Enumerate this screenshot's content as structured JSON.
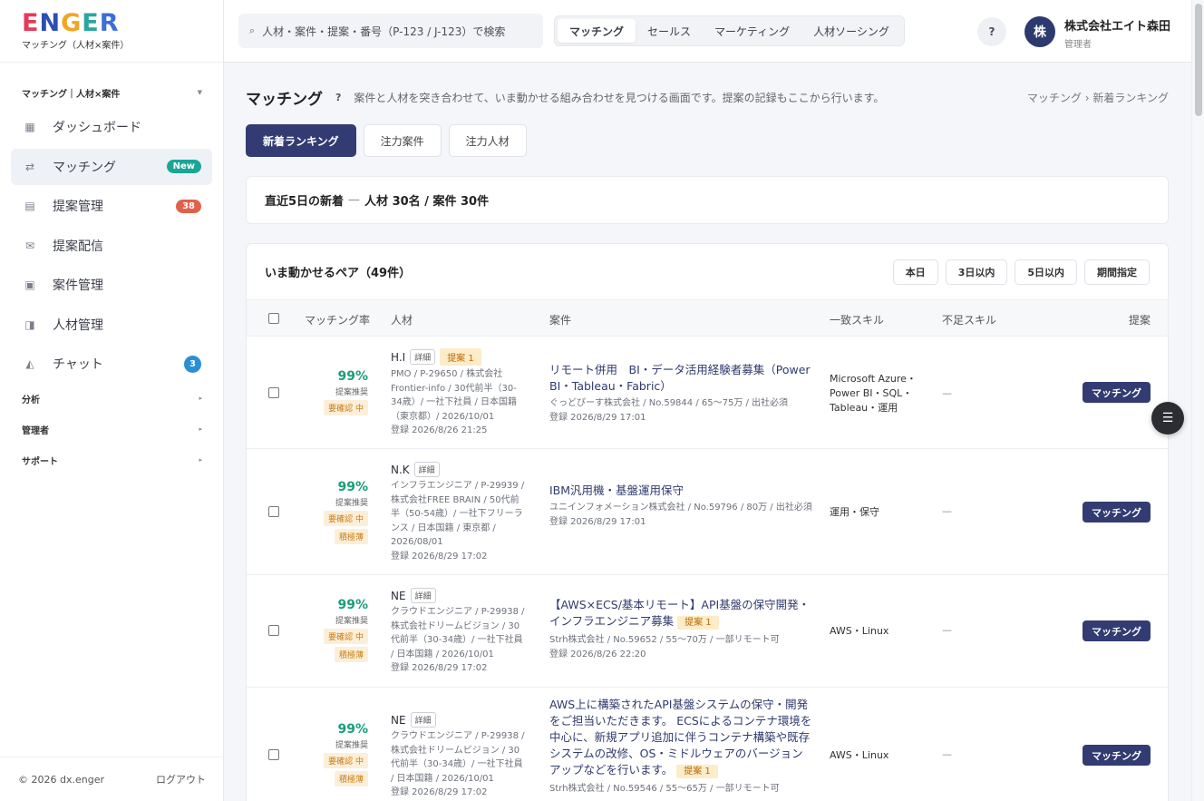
{
  "brand": {
    "logo": "ENGER",
    "subtitle": "マッチング（人材×案件）"
  },
  "sidebar": {
    "section_main": "マッチング｜人材×案件",
    "items": [
      {
        "label": "ダッシュボード",
        "icon": "grid-icon",
        "glyph": "▦"
      },
      {
        "label": "マッチング",
        "icon": "arrows-icon",
        "glyph": "⇄",
        "badge": "New"
      },
      {
        "label": "提案管理",
        "icon": "list-icon",
        "glyph": "▤",
        "badge": "38"
      },
      {
        "label": "提案配信",
        "icon": "mail-icon",
        "glyph": "✉"
      },
      {
        "label": "案件管理",
        "icon": "folder-icon",
        "glyph": "▣"
      },
      {
        "label": "人材管理",
        "icon": "person-icon",
        "glyph": "◨"
      },
      {
        "label": "チャット",
        "icon": "chat-icon",
        "glyph": "◭",
        "badge": "3"
      }
    ],
    "section_analysis": "分析",
    "section_admin": "管理者",
    "section_support": "サポート",
    "copyright": "© 2026 dx.enger",
    "logout": "ログアウト"
  },
  "topbar": {
    "search_placeholder": "人材・案件・提案・番号（P-123 / J-123）で検索",
    "modes": [
      "マッチング",
      "セールス",
      "マーケティング",
      "人材ソーシング"
    ],
    "help": "?",
    "avatar": "株",
    "user_name": "株式会社エイト森田",
    "user_role": "管理者"
  },
  "page": {
    "title": "マッチング",
    "help": "?",
    "description": "案件と人材を突き合わせて、いま動かせる組み合わせを見つける画面です。提案の記録もここから行います。",
    "breadcrumb": "マッチング › 新着ランキング",
    "tabs": [
      "新着ランキング",
      "注力案件",
      "注力人材"
    ],
    "summary_label": "直近5日の新着",
    "summary_dash": "—",
    "summary_value": "人材 30名 / 案件 30件"
  },
  "pairs": {
    "title": "いま動かせるペア（49件）",
    "filters": [
      "本日",
      "3日以内",
      "5日以内",
      "期間指定"
    ],
    "columns": [
      "マッチング率",
      "人材",
      "案件",
      "一致スキル",
      "不足スキル",
      "提案"
    ],
    "rows": [
      {
        "rate": "99%",
        "rate_label": "提案推奨",
        "tags": [
          "要確認 中"
        ],
        "name": "H.I",
        "detail": "詳細",
        "proposal": "提案 1",
        "info": "PMO / P-29650 / 株式会社Frontier-info / 30代前半（30-34歳）/ 一社下社員 / 日本国籍（東京都）/ 2026/10/01",
        "registered": "登録 2026/8/26 21:25",
        "job_title": "リモート併用　BI・データ活用経験者募集（Power BI・Tableau・Fabric）",
        "job_proposal": "",
        "job_info": "ぐっどぴーす株式会社 / No.59844 / 65〜75万 / 出社必須",
        "job_registered": "登録 2026/8/29 17:01",
        "skills": "Microsoft Azure・Power BI・SQL・Tableau・運用",
        "lack": "—",
        "action": "マッチング"
      },
      {
        "rate": "99%",
        "rate_label": "提案推奨",
        "tags": [
          "要確認 中",
          "積極薄"
        ],
        "name": "N.K",
        "detail": "詳細",
        "proposal": "",
        "info": "インフラエンジニア / P-29939 / 株式会社FREE BRAIN / 50代前半（50-54歳）/ 一社下フリーランス / 日本国籍 / 東京都 / 2026/08/01",
        "registered": "登録 2026/8/29 17:02",
        "job_title": "IBM汎用機・基盤運用保守",
        "job_proposal": "",
        "job_info": "ユニインフォメーション株式会社 / No.59796 / 80万 / 出社必須",
        "job_registered": "登録 2026/8/29 17:01",
        "skills": "運用・保守",
        "lack": "—",
        "action": "マッチング"
      },
      {
        "rate": "99%",
        "rate_label": "提案推奨",
        "tags": [
          "要確認 中",
          "積極薄"
        ],
        "name": "NE",
        "detail": "詳細",
        "proposal": "",
        "info": "クラウドエンジニア / P-29938 / 株式会社ドリームビジョン / 30代前半（30-34歳）/ 一社下社員 / 日本国籍 / 2026/10/01",
        "registered": "登録 2026/8/29 17:02",
        "job_title": "【AWS×ECS/基本リモート】API基盤の保守開発・インフラエンジニア募集",
        "job_proposal": "提案 1",
        "job_info": "Strh株式会社 / No.59652 / 55〜70万 / 一部リモート可",
        "job_registered": "登録 2026/8/26 22:20",
        "skills": "AWS・Linux",
        "lack": "—",
        "action": "マッチング"
      },
      {
        "rate": "99%",
        "rate_label": "提案推奨",
        "tags": [
          "要確認 中",
          "積極薄"
        ],
        "name": "NE",
        "detail": "詳細",
        "proposal": "",
        "info": "クラウドエンジニア / P-29938 / 株式会社ドリームビジョン / 30代前半（30-34歳）/ 一社下社員 / 日本国籍 / 2026/10/01",
        "registered": "登録 2026/8/29 17:02",
        "job_title": "AWS上に構築されたAPI基盤システムの保守・開発をご担当いただきます。 ECSによるコンテナ環境を中心に、新規アプリ追加に伴うコンテナ構築や既存システムの改修、OS・ミドルウェアのバージョンアップなどを行います。",
        "job_proposal": "提案 1",
        "job_info": "Strh株式会社 / No.59546 / 55〜65万 / 一部リモート可",
        "job_registered": "",
        "skills": "AWS・Linux",
        "lack": "—",
        "action": "マッチング"
      }
    ]
  },
  "fab": {
    "icon": "filter-icon"
  },
  "colors": {
    "primary": "#323c72",
    "accent_green": "#1a9e7a",
    "badge_red": "#e0614a",
    "badge_teal": "#1aa696",
    "badge_blue": "#2b8fd6"
  }
}
